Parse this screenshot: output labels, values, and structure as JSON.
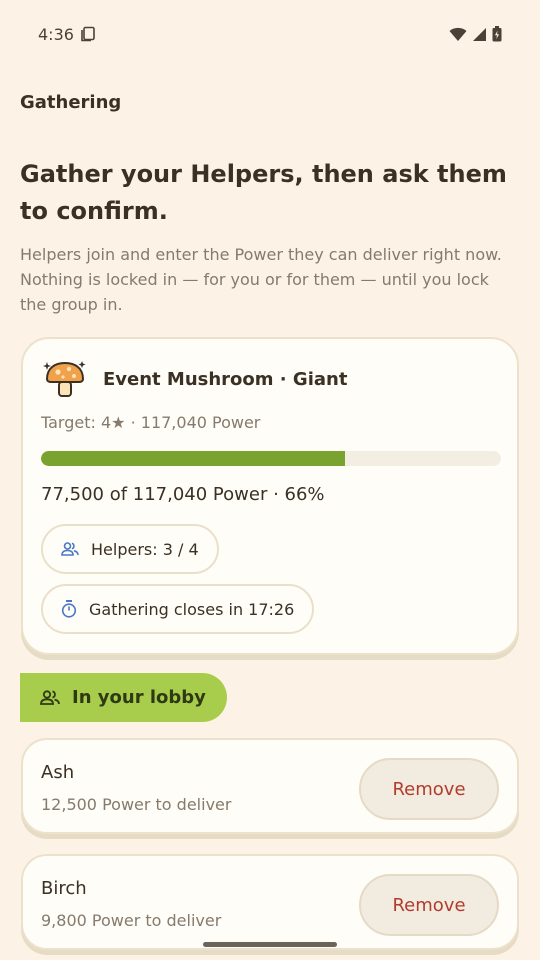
{
  "status": {
    "time": "4:36"
  },
  "app": {
    "title": "Gathering"
  },
  "headline": "Gather your Helpers, then ask them to confirm.",
  "intro": "Helpers join and enter the Power they can deliver right now. Nothing is locked in — for you or for them — until you lock the group in.",
  "event": {
    "name": "Event Mushroom · Giant",
    "target": "Target: 4★ · 117,040 Power",
    "progress_fraction": 0.66,
    "progress_text": "77,500 of 117,040 Power · 66%",
    "helpers": "Helpers: 3 / 4",
    "timer": "Gathering closes in 17:26"
  },
  "lobby": {
    "title": "In your lobby",
    "helpers": [
      {
        "name": "Ash",
        "power": "12,500 Power to deliver",
        "action": "Remove"
      },
      {
        "name": "Birch",
        "power": "9,800 Power to deliver",
        "action": "Remove"
      }
    ]
  },
  "colors": {
    "background": "#fcf3e6",
    "accent_green": "#7aa22e",
    "lobby_green": "#a8cc4c",
    "remove_red": "#b23b2c",
    "icon_blue": "#4a78c8"
  }
}
